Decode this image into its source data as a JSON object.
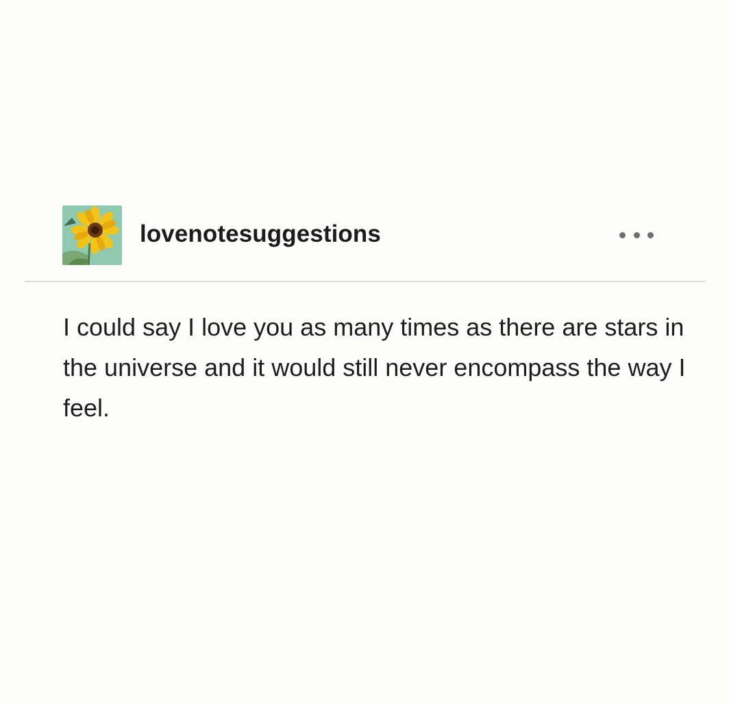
{
  "post": {
    "username": "lovenotesuggestions",
    "avatar_icon": "sunflower-avatar",
    "more_icon": "ellipsis-icon",
    "body_text": "I could say I love you as many times as there are stars in the universe and it would still never encompass the way I feel."
  },
  "colors": {
    "background": "#fdfdfc",
    "text": "#1d1d1d",
    "divider": "#dcdcdc",
    "avatar_bg": "#8fc9b0",
    "sunflower_petal": "#f2c318"
  }
}
